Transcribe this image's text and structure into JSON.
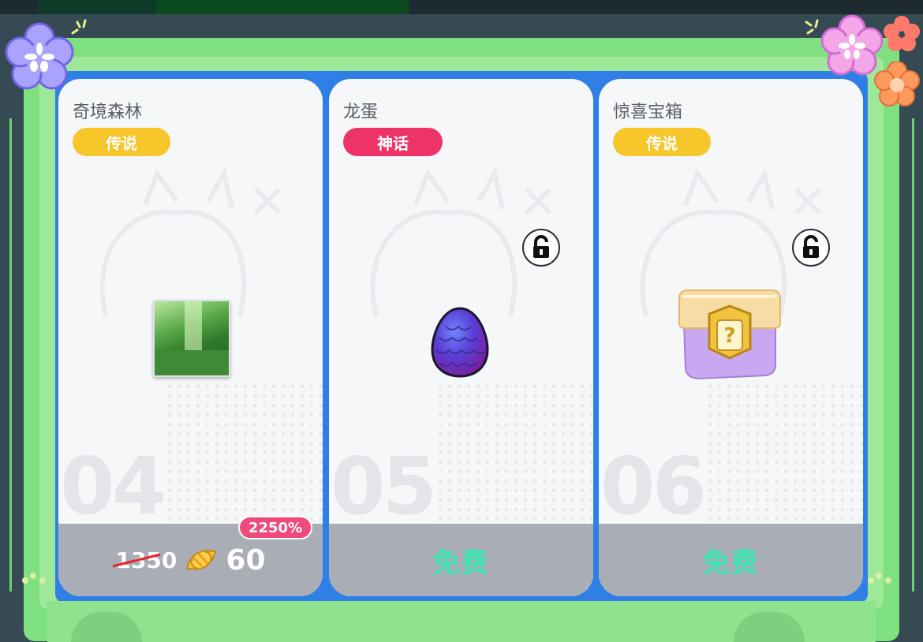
{
  "cards": [
    {
      "title": "奇境森林",
      "rarity": "传说",
      "number": "04",
      "item": "forest-scene-image",
      "old_price": "1350",
      "currency": "candy-icon",
      "new_price": "60",
      "discount": "2250%"
    },
    {
      "title": "龙蛋",
      "rarity": "神话",
      "number": "05",
      "item": "dragon-egg-image",
      "price_label": "免费",
      "locked": true
    },
    {
      "title": "惊喜宝箱",
      "rarity": "传说",
      "number": "06",
      "item": "surprise-chest-image",
      "price_label": "免费",
      "locked": true
    }
  ],
  "colors": {
    "legend_badge": "#f6c62b",
    "myth_badge": "#ee3467",
    "free_text": "#3ee6b2",
    "frame_green": "#7fe07f",
    "card_bg": "#f6f7f9",
    "footer": "#a8adb6"
  },
  "decorations": [
    "flower-icon",
    "sparkle-icon"
  ]
}
